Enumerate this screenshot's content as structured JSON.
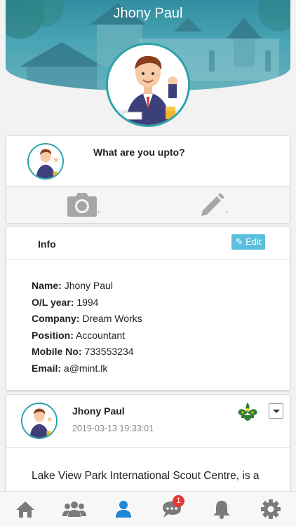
{
  "header": {
    "title": "Jhony Paul"
  },
  "composer": {
    "prompt": "What are you upto?",
    "photo_dot": ".",
    "write_dot": "."
  },
  "info": {
    "title": "Info",
    "edit_label": "Edit",
    "fields": [
      {
        "label": "Name:",
        "value": "Jhony Paul"
      },
      {
        "label": "O/L year:",
        "value": "1994"
      },
      {
        "label": "Company:",
        "value": "Dream Works"
      },
      {
        "label": "Position:",
        "value": "Accountant"
      },
      {
        "label": "Mobile No:",
        "value": "733553234"
      },
      {
        "label": "Email:",
        "value": "a@mint.lk"
      }
    ]
  },
  "feed": {
    "author": "Jhony Paul",
    "timestamp": "2019-03-13 19:33:01",
    "text": "Lake View Park International Scout Centre, is a"
  },
  "navbar": {
    "items": [
      "home-icon",
      "users-icon",
      "profile-icon",
      "chat-icon",
      "bell-icon",
      "gear-icon"
    ],
    "chat_badge": "1",
    "active_color": "#1e88d6",
    "inactive_color": "#7a7a7a"
  },
  "colors": {
    "accent": "#2aa3a8",
    "edit": "#5bc0de",
    "badge": "#e53935"
  }
}
